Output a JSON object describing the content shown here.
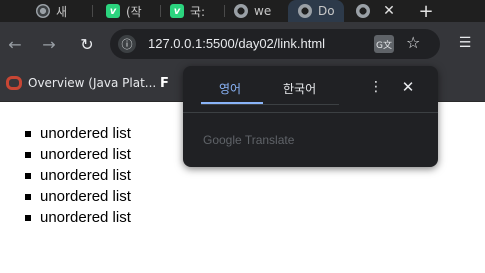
{
  "tabs": [
    {
      "title": "새",
      "icon": "chrome-icon"
    },
    {
      "title": "(작",
      "icon": "v-icon"
    },
    {
      "title": "국:",
      "icon": "v-icon"
    },
    {
      "title": "we",
      "icon": "globe-icon"
    },
    {
      "title": "Do",
      "icon": "globe-icon",
      "active": true
    },
    {
      "title": "",
      "icon": "globe-icon"
    }
  ],
  "toolbar": {
    "back_icon": "←",
    "forward_icon": "→",
    "reload_icon": "↻",
    "site_info_icon": "ⓘ",
    "url": "127.0.0.1:5500/day02/link.html",
    "star_icon": "☆",
    "new_tab_label": "+",
    "close_tab_label": "✕"
  },
  "bookmarks": [
    {
      "label": "Overview (Java Plat...",
      "icon": "oracle-icon"
    },
    {
      "label": "F",
      "icon": "f-icon"
    }
  ],
  "page": {
    "list_items": [
      "unordered list",
      "unordered list",
      "unordered list",
      "unordered list",
      "unordered list"
    ]
  },
  "translate_popup": {
    "tab_source": "영어",
    "tab_target": "한국어",
    "more_icon": "⋮",
    "close_icon": "✕",
    "brand": "Google Translate"
  },
  "colors": {
    "accent": "#8ab4f8",
    "toolbar_bg": "#35363a",
    "tabstrip_bg": "#1f1f1f",
    "popup_bg": "#202124"
  }
}
